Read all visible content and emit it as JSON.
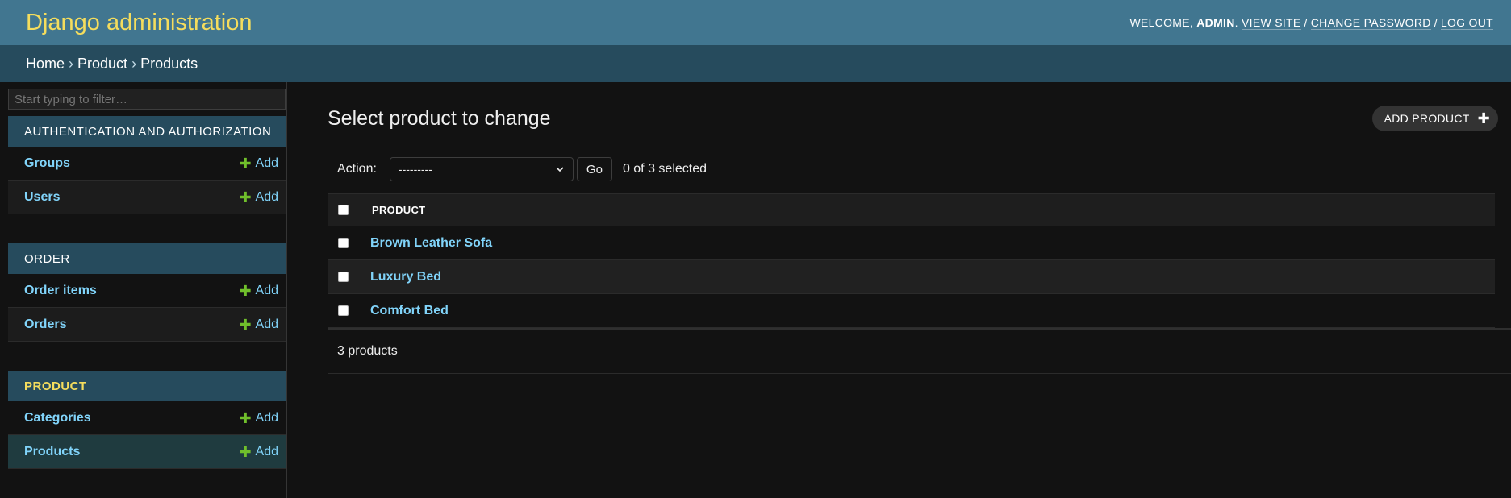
{
  "header": {
    "site_name": "Django administration",
    "welcome": "Welcome, ",
    "username": "admin",
    "view_site": "View site",
    "change_password": "Change password",
    "log_out": "Log out",
    "sep": "/",
    "branding_color": "#f5dd5d",
    "header_bg": "#417690"
  },
  "breadcrumbs": {
    "home": "Home",
    "app": "Product",
    "current": "Products",
    "separator": "›"
  },
  "sidebar": {
    "filter_placeholder": "Start typing to filter…",
    "add_label": "Add",
    "modules": [
      {
        "caption": "Authentication and Authorization",
        "models": [
          {
            "name": "Groups"
          },
          {
            "name": "Users"
          }
        ]
      },
      {
        "caption": "Order",
        "models": [
          {
            "name": "Order items"
          },
          {
            "name": "Orders"
          }
        ]
      },
      {
        "caption": "Product",
        "current": true,
        "models": [
          {
            "name": "Categories"
          },
          {
            "name": "Products",
            "selected": true
          }
        ]
      }
    ]
  },
  "content": {
    "title": "Select product to change",
    "add_button": "Add product",
    "action_label": "Action:",
    "action_select_value": "---------",
    "go_label": "Go",
    "action_counter": "0 of 3 selected",
    "column_header": "Product",
    "rows": [
      {
        "name": "Brown Leather Sofa"
      },
      {
        "name": "Luxury Bed"
      },
      {
        "name": "Comfort Bed"
      }
    ],
    "paginator": "3 products"
  }
}
